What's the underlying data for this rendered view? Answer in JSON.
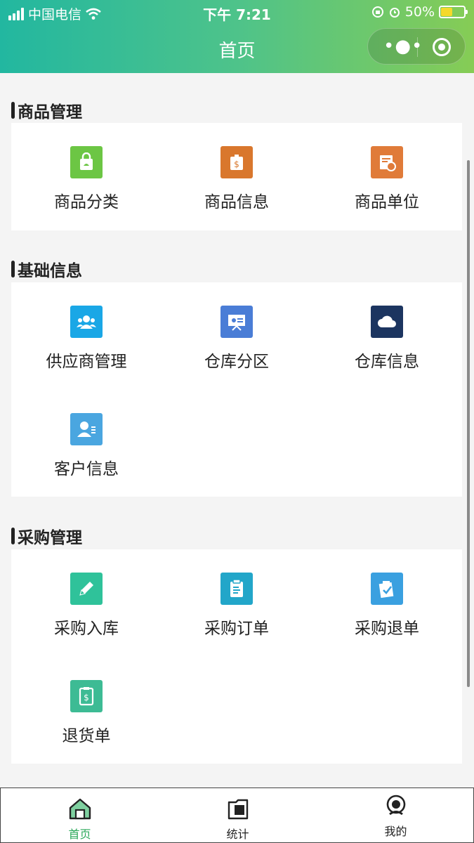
{
  "status_bar": {
    "carrier": "中国电信",
    "time": "下午 7:21",
    "battery": "50%",
    "battery_level": 0.5
  },
  "nav": {
    "title": "首页"
  },
  "sections": [
    {
      "title": "商品管理",
      "items": [
        {
          "label": "商品分类",
          "icon": "bag-icon",
          "color": "#6cc644"
        },
        {
          "label": "商品信息",
          "icon": "price-tag-icon",
          "color": "#d9772d"
        },
        {
          "label": "商品单位",
          "icon": "certificate-icon",
          "color": "#e07b39"
        }
      ]
    },
    {
      "title": "基础信息",
      "items": [
        {
          "label": "供应商管理",
          "icon": "group-icon",
          "color": "#1aa7e6"
        },
        {
          "label": "仓库分区",
          "icon": "presentation-icon",
          "color": "#4a7dd6"
        },
        {
          "label": "仓库信息",
          "icon": "cloud-icon",
          "color": "#1c3560"
        },
        {
          "label": "客户信息",
          "icon": "contact-card-icon",
          "color": "#4aa6e0"
        }
      ]
    },
    {
      "title": "采购管理",
      "items": [
        {
          "label": "采购入库",
          "icon": "pencil-icon",
          "color": "#2fc29a"
        },
        {
          "label": "采购订单",
          "icon": "clipboard-icon",
          "color": "#22a6c9"
        },
        {
          "label": "采购退单",
          "icon": "checklist-icon",
          "color": "#3aa0e0"
        },
        {
          "label": "退货单",
          "icon": "receipt-icon",
          "color": "#3dbb94"
        }
      ]
    }
  ],
  "tabbar": [
    {
      "label": "首页",
      "icon": "home-icon",
      "active": true
    },
    {
      "label": "统计",
      "icon": "document-icon",
      "active": false
    },
    {
      "label": "我的",
      "icon": "user-icon",
      "active": false
    }
  ],
  "colors": {
    "accent": "#2aa85a",
    "header_start": "#22b7a0",
    "header_end": "#86cc55"
  }
}
